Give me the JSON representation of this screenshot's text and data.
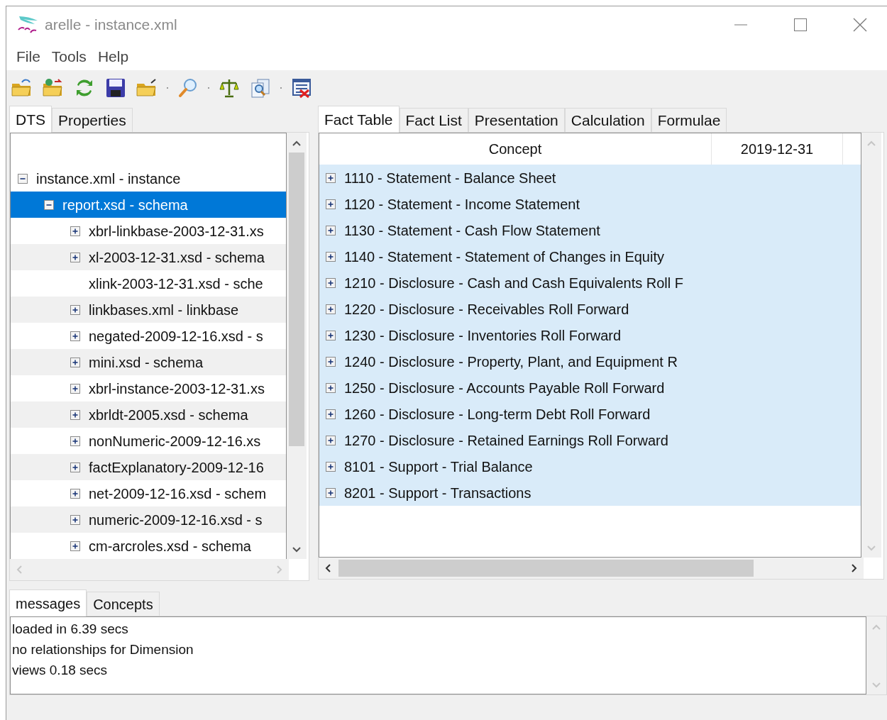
{
  "window": {
    "title": "arelle - instance.xml"
  },
  "menu": [
    "File",
    "Tools",
    "Help"
  ],
  "left_tabs": [
    {
      "label": "DTS",
      "selected": true
    },
    {
      "label": "Properties",
      "selected": false
    }
  ],
  "tree": [
    {
      "label": "instance.xml - instance",
      "kind": "node",
      "expanded": true,
      "selected": false,
      "children": [
        {
          "label": "report.xsd - schema",
          "kind": "node",
          "expanded": true,
          "selected": true,
          "children": [
            {
              "label": "xbrl-linkbase-2003-12-31.xs",
              "kind": "node",
              "expanded": false,
              "selected": false
            },
            {
              "label": "xl-2003-12-31.xsd - schema",
              "kind": "node",
              "expanded": false,
              "selected": false
            },
            {
              "label": "xlink-2003-12-31.xsd - sche",
              "kind": "leaf",
              "selected": false
            },
            {
              "label": "linkbases.xml - linkbase",
              "kind": "node",
              "expanded": false,
              "selected": false
            },
            {
              "label": "negated-2009-12-16.xsd - s",
              "kind": "node",
              "expanded": false,
              "selected": false
            },
            {
              "label": "mini.xsd - schema",
              "kind": "node",
              "expanded": false,
              "selected": false
            },
            {
              "label": "xbrl-instance-2003-12-31.xs",
              "kind": "node",
              "expanded": false,
              "selected": false
            },
            {
              "label": "xbrldt-2005.xsd - schema",
              "kind": "node",
              "expanded": false,
              "selected": false
            },
            {
              "label": "nonNumeric-2009-12-16.xs",
              "kind": "node",
              "expanded": false,
              "selected": false
            },
            {
              "label": "factExplanatory-2009-12-16",
              "kind": "node",
              "expanded": false,
              "selected": false
            },
            {
              "label": "net-2009-12-16.xsd - schem",
              "kind": "node",
              "expanded": false,
              "selected": false
            },
            {
              "label": "numeric-2009-12-16.xsd - s",
              "kind": "node",
              "expanded": false,
              "selected": false
            },
            {
              "label": "cm-arcroles.xsd - schema",
              "kind": "node",
              "expanded": false,
              "selected": false
            }
          ]
        }
      ]
    }
  ],
  "right_tabs": [
    {
      "label": "Fact Table",
      "selected": true
    },
    {
      "label": "Fact List",
      "selected": false
    },
    {
      "label": "Presentation",
      "selected": false
    },
    {
      "label": "Calculation",
      "selected": false
    },
    {
      "label": "Formulae",
      "selected": false
    }
  ],
  "fact_table": {
    "columns": [
      "Concept",
      "2019-12-31"
    ],
    "rows": [
      {
        "label": "1110 - Statement - Balance Sheet",
        "expanded": false
      },
      {
        "label": "1120 - Statement - Income Statement",
        "expanded": false
      },
      {
        "label": "1130 - Statement - Cash Flow Statement",
        "expanded": false
      },
      {
        "label": "1140 - Statement - Statement of Changes in Equity",
        "expanded": false
      },
      {
        "label": "1210 - Disclosure - Cash and Cash Equivalents Roll F",
        "expanded": false
      },
      {
        "label": "1220 - Disclosure - Receivables Roll Forward",
        "expanded": false
      },
      {
        "label": "1230 - Disclosure - Inventories Roll Forward",
        "expanded": false
      },
      {
        "label": "1240 - Disclosure - Property, Plant, and Equipment R",
        "expanded": false
      },
      {
        "label": "1250 - Disclosure - Accounts Payable Roll Forward",
        "expanded": false
      },
      {
        "label": "1260 - Disclosure - Long-term Debt Roll Forward",
        "expanded": false
      },
      {
        "label": "1270 - Disclosure - Retained Earnings Roll Forward",
        "expanded": false
      },
      {
        "label": "8101 - Support - Trial Balance",
        "expanded": false
      },
      {
        "label": "8201 - Support - Transactions",
        "expanded": false
      }
    ]
  },
  "bottom_tabs": [
    {
      "label": "messages",
      "selected": true
    },
    {
      "label": "Concepts",
      "selected": false
    }
  ],
  "messages": [
    "loaded in 6.39 secs",
    "no relationships for Dimension",
    "views 0.18 secs"
  ]
}
